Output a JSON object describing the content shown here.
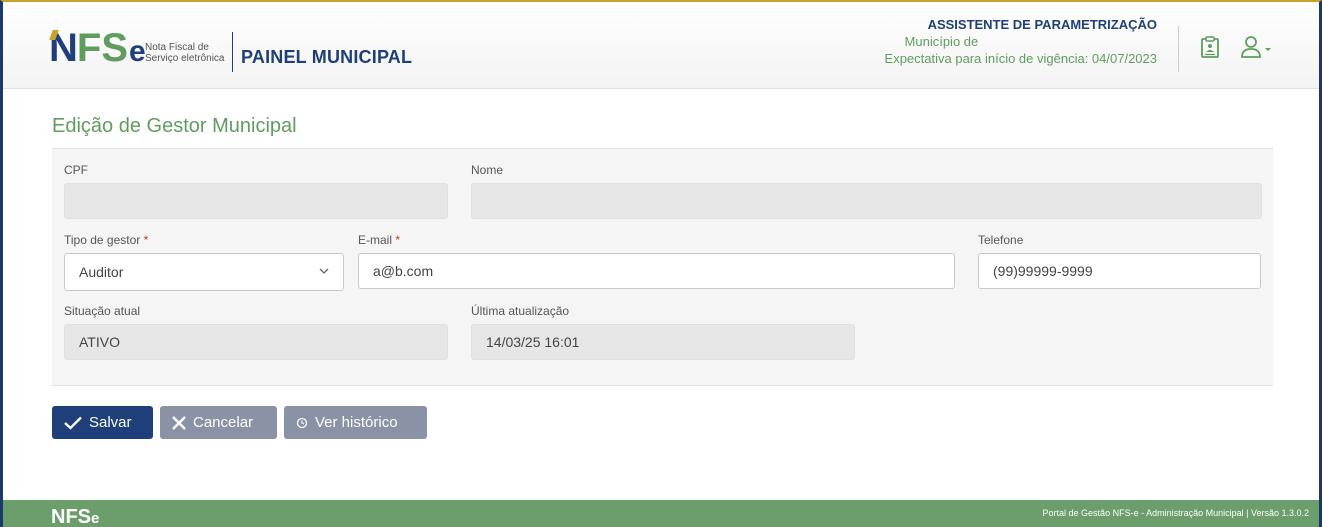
{
  "header": {
    "logo_n": "N",
    "logo_fs": "FS",
    "logo_e": "e",
    "logo_sub_line1": "Nota Fiscal de",
    "logo_sub_line2": "Serviço eletrônica",
    "panel_title": "PAINEL MUNICIPAL",
    "assistant_title": "ASSISTENTE DE PARAMETRIZAÇÃO",
    "municipality_label": "Município de",
    "validity_label": "Expectativa para início de vigência: 04/07/2023",
    "icons": [
      "clipboard-icon",
      "user-icon",
      "caret-down-icon"
    ]
  },
  "page": {
    "title": "Edição de Gestor Municipal"
  },
  "form": {
    "cpf_label": "CPF",
    "cpf_value": "",
    "name_label": "Nome",
    "name_value": "",
    "type_label": "Tipo de gestor",
    "required_mark": "*",
    "type_value": "Auditor",
    "email_label": "E-mail",
    "email_value": "a@b.com",
    "phone_label": "Telefone",
    "phone_placeholder": "(99)99999-9999",
    "status_label": "Situação atual",
    "status_value": "ATIVO",
    "updated_label": "Última atualização",
    "updated_value": "14/03/25 16:01"
  },
  "actions": {
    "save_label": "Salvar",
    "cancel_label": "Cancelar",
    "history_label": "Ver histórico"
  },
  "footer": {
    "logo": "NFS",
    "logo_e": "e",
    "text": "Portal de Gestão NFS-e - Administração Municipal | Versão 1.3.0.2"
  },
  "colors": {
    "primary": "#1f3f7a",
    "green": "#5f9d5f",
    "footer": "#6b9e6b",
    "secondary_button": "#8a93a6"
  }
}
